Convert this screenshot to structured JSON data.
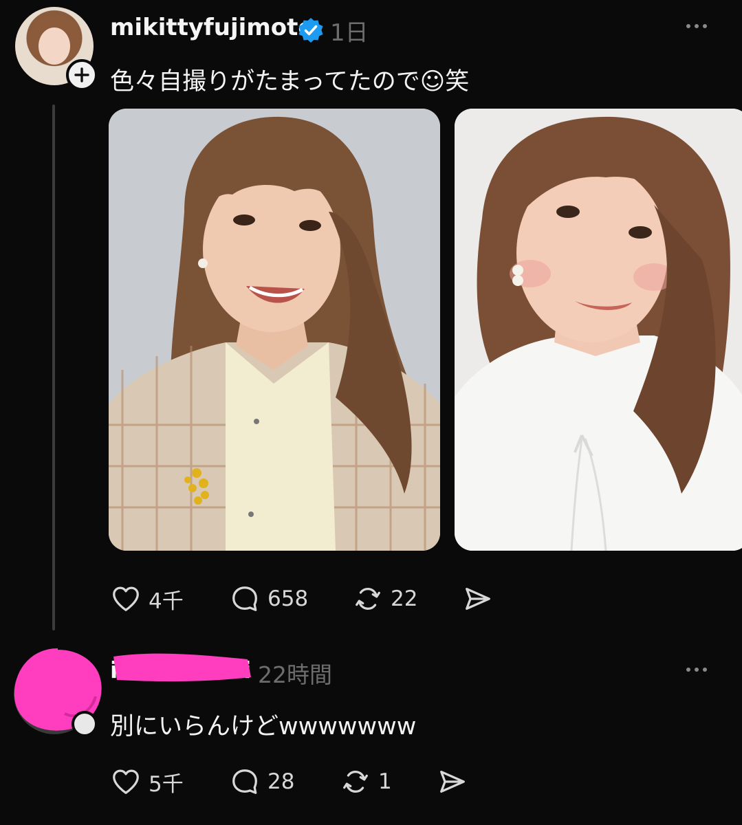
{
  "post": {
    "username": "mikittyfujimoto",
    "time": "1日",
    "text": "色々自撮りがたまってたので☺笑",
    "actions": {
      "likes": "4千",
      "replies": "658",
      "reposts": "22"
    }
  },
  "reply": {
    "username_visible_start": "i.",
    "username_visible_end": "i",
    "time": "22時間",
    "text": "別にいらんけどwwwwwww",
    "actions": {
      "likes": "5千",
      "replies": "28",
      "reposts": "1"
    }
  },
  "colors": {
    "background": "#0a0a0a",
    "verified": "#1d9bf0",
    "redaction": "#ff3ebf",
    "muted_text": "#6d6d6d"
  },
  "icons": [
    "plus-icon",
    "verified-badge-icon",
    "more-icon",
    "heart-icon",
    "reply-icon",
    "repost-icon",
    "share-icon"
  ]
}
